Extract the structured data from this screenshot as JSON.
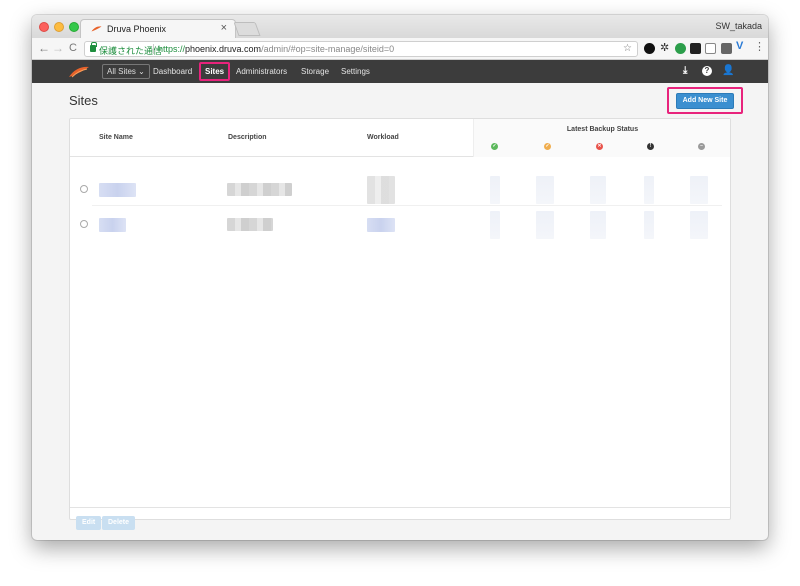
{
  "browser": {
    "tab_title": "Druva Phoenix",
    "tab_close": "×",
    "user": "SW_takada",
    "secure_label": "保護された通信",
    "url_scheme": "https://",
    "url_host": "phoenix.druva.com",
    "url_path": "/admin/#op=site-manage/siteid=0",
    "nav_back": "←",
    "nav_forward": "→",
    "nav_reload": "C",
    "star": "☆"
  },
  "app": {
    "site_selector": "All Sites ⌄",
    "nav": {
      "dashboard": "Dashboard",
      "sites": "Sites",
      "administrators": "Administrators",
      "storage": "Storage",
      "settings": "Settings"
    },
    "icons": {
      "download": "⤓",
      "help": "?",
      "user": "👤"
    }
  },
  "page": {
    "title": "Sites",
    "add_button": "Add New Site"
  },
  "table": {
    "headers": {
      "site_name": "Site Name",
      "description": "Description",
      "workload": "Workload",
      "latest_backup_status": "Latest Backup Status"
    },
    "status_icons": [
      {
        "name": "success-icon",
        "glyph": "✓",
        "color": "#5cb85c"
      },
      {
        "name": "warning-icon",
        "glyph": "✓",
        "color": "#f0ad4e"
      },
      {
        "name": "failed-icon",
        "glyph": "✕",
        "color": "#e8524a"
      },
      {
        "name": "error-icon",
        "glyph": "!",
        "color": "#333333"
      },
      {
        "name": "skipped-icon",
        "glyph": "–",
        "color": "#9a9a9a"
      }
    ]
  },
  "footer": {
    "edit": "Edit",
    "delete": "Delete"
  },
  "colors": {
    "accent": "#3b8fd0",
    "highlight": "#e8237c",
    "header_bg": "#3c3c3c"
  }
}
